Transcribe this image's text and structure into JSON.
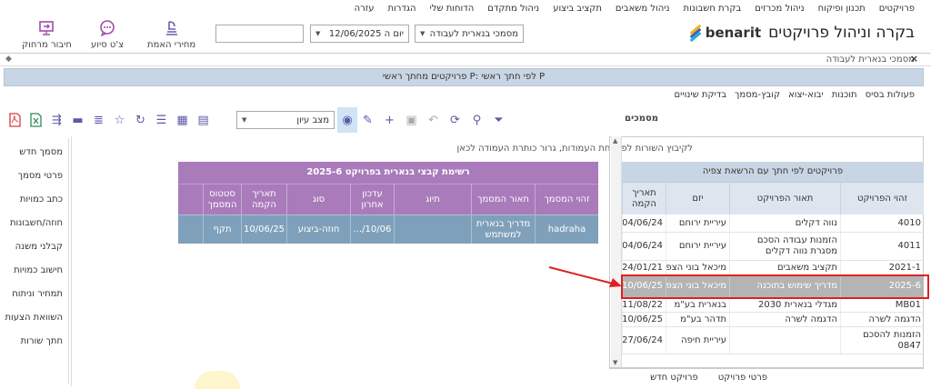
{
  "topnav": [
    "פרויקטים",
    "תכנון ופיקוח",
    "ניהול מכרזים",
    "בקרת חשבונות",
    "ניהול משאבים",
    "תקציב ביצוע",
    "ניהול מתקדם",
    "הדוחות שלי",
    "הגדרות",
    "עזרה"
  ],
  "logo": {
    "text": "בקרה וניהול פרויקטים",
    "brand": "benarit"
  },
  "header": {
    "library_select": "מסמכי בנארית לעבודה",
    "date_select": "יום ה 12/06/2025",
    "search_value": "",
    "buttons": [
      {
        "label": "מחירי האמת",
        "icon": "price-icon"
      },
      {
        "label": "צ'ט סיוע",
        "icon": "chat-icon"
      },
      {
        "label": "חיבור מרחוק",
        "icon": "remote-connect-icon"
      }
    ]
  },
  "subtitle": "מסמכי בנארית לעבודה",
  "banner": "פרויקטים מחתך ראשי P: לפי חתך ראשי P",
  "tabs": [
    "פעולות בסיס",
    "תוכנות",
    "יבוא-יצוא",
    "קובץ-מסמך",
    "בדיקת שינויים"
  ],
  "toolbar": {
    "status_select": "מצב עיון",
    "docs_label": "מסמכים"
  },
  "sidebar": [
    "מסמך חדש",
    "פרטי מסמך",
    "כתב כמויות",
    "חוזה/חשבונות",
    "קבלני משנה",
    "חישוב כמויות",
    "תמחיר וניתוח",
    "השוואת הצעות",
    "חתך שורות"
  ],
  "files": {
    "group_hint": "לקיבוץ השורות לפי אחת העמודות, גרור כותרת העמודה לכאן",
    "title": "רשימת קבצי בנארית בפרויקט 2025-6",
    "columns": [
      "זהוי המסמך",
      "תאור המסמך",
      "תיוג",
      "עדכון אחרון",
      "סוג",
      "תאריך הקמה",
      "סטטוס המסמך"
    ],
    "rows": [
      [
        "hadraha",
        "מדריך בנארית למשתמש",
        "",
        "10/06/...",
        "חוזה-ביצוע",
        "10/06/25",
        "תקף"
      ]
    ]
  },
  "projects": {
    "title": "פרויקטים לפי חתך עם הרשאת צפיה",
    "columns": [
      "זהוי הפרויקט",
      "תאור הפרויקט",
      "יזם",
      "תאריך הקמה"
    ],
    "rows": [
      [
        "4010",
        "נווה דקלים",
        "עיריית ירוחם",
        "04/06/24"
      ],
      [
        "4011",
        "הזמנות עבודה הסכם מסגרת נווה דקלים",
        "עיריית ירוחם",
        "04/06/24"
      ],
      [
        "2021-1",
        "תקציב משאבים",
        "מיכאל בוני הצפ",
        "24/01/21"
      ],
      [
        "2025-6",
        "מדריך שימוש בתוכנה",
        "מיכאל בוני הצפ...",
        "10/06/25"
      ],
      [
        "MB01",
        "מגדלי בנארית 2030",
        "בנארית בע\"מ",
        "11/08/22"
      ],
      [
        "הדגמה לשרה",
        "הדגמה לשרה",
        "תדהר בע\"מ",
        "10/06/25"
      ],
      [
        "הזמנות להסכם 0847",
        "",
        "עיריית חיפה",
        "27/06/24"
      ]
    ]
  },
  "bottombar": [
    "פרטי פרויקט",
    "פרויקט חדש"
  ],
  "colors": {
    "purple": "#a97bbb",
    "steel": "#7fa0ba",
    "highlight_red": "#e02020"
  }
}
